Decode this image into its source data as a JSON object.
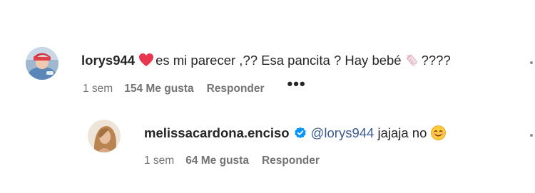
{
  "comments": [
    {
      "username": "lorys944",
      "text": "es mi parecer ,?? Esa pancita ? Hay bebé",
      "text_suffix": "????",
      "time": "1 sem",
      "likes": "154 Me gusta",
      "reply_label": "Responder",
      "more_label": "•••",
      "icons": [
        "heart-emoji-icon",
        "baby-bottle-emoji-icon"
      ]
    },
    {
      "username": "melissacardona.enciso",
      "mention": "@lorys944",
      "text": "jajaja no",
      "time": "1 sem",
      "likes": "64 Me gusta",
      "reply_label": "Responder",
      "icons": [
        "verified-badge-icon",
        "smiling-face-emoji-icon"
      ]
    }
  ],
  "colors": {
    "text": "#262626",
    "secondary": "#737373",
    "mention": "#3a5a95",
    "verified": "#0095f6",
    "heart": "#e8364f"
  }
}
